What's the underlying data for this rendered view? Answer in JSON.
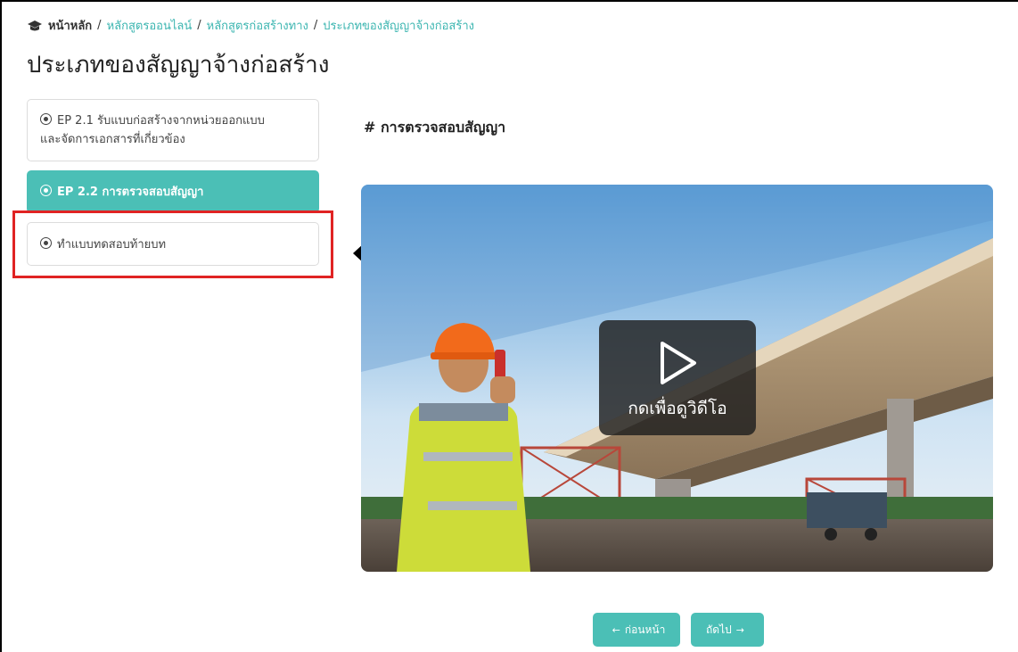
{
  "breadcrumb": {
    "home": "หน้าหลัก",
    "separator": "/",
    "items": [
      "หลักสูตรออนไลน์",
      "หลักสูตรก่อสร้างทาง",
      "ประเภทของสัญญาจ้างก่อสร้าง"
    ]
  },
  "page": {
    "title": "ประเภทของสัญญาจ้างก่อสร้าง"
  },
  "lessons": [
    {
      "label_line1": "EP 2.1 รับแบบก่อสร้างจากหน่วยออกแบบ",
      "label_line2": "และจัดการเอกสารที่เกี่ยวข้อง",
      "active": false
    },
    {
      "label": "EP 2.2 การตรวจสอบสัญญา",
      "active": true
    },
    {
      "label": "ทำแบบทดสอบท้ายบท",
      "active": false
    }
  ],
  "content": {
    "heading": "# การตรวจสอบสัญญา",
    "video": {
      "play_label": "กดเพื่อดูวิดีโอ"
    }
  },
  "navigation": {
    "prev_label": "ก่อนหน้า",
    "next_label": "ถัดไป",
    "prev_arrow": "←",
    "next_arrow": "→"
  },
  "colors": {
    "accent": "#4bbfb6",
    "breadcrumb_link": "#3bb5b0",
    "highlight": "#e02323"
  },
  "icons": {
    "home": "graduation-cap-icon",
    "lesson": "radio-dot-icon",
    "play": "play-icon",
    "annotation": "arrow-left-icon"
  }
}
